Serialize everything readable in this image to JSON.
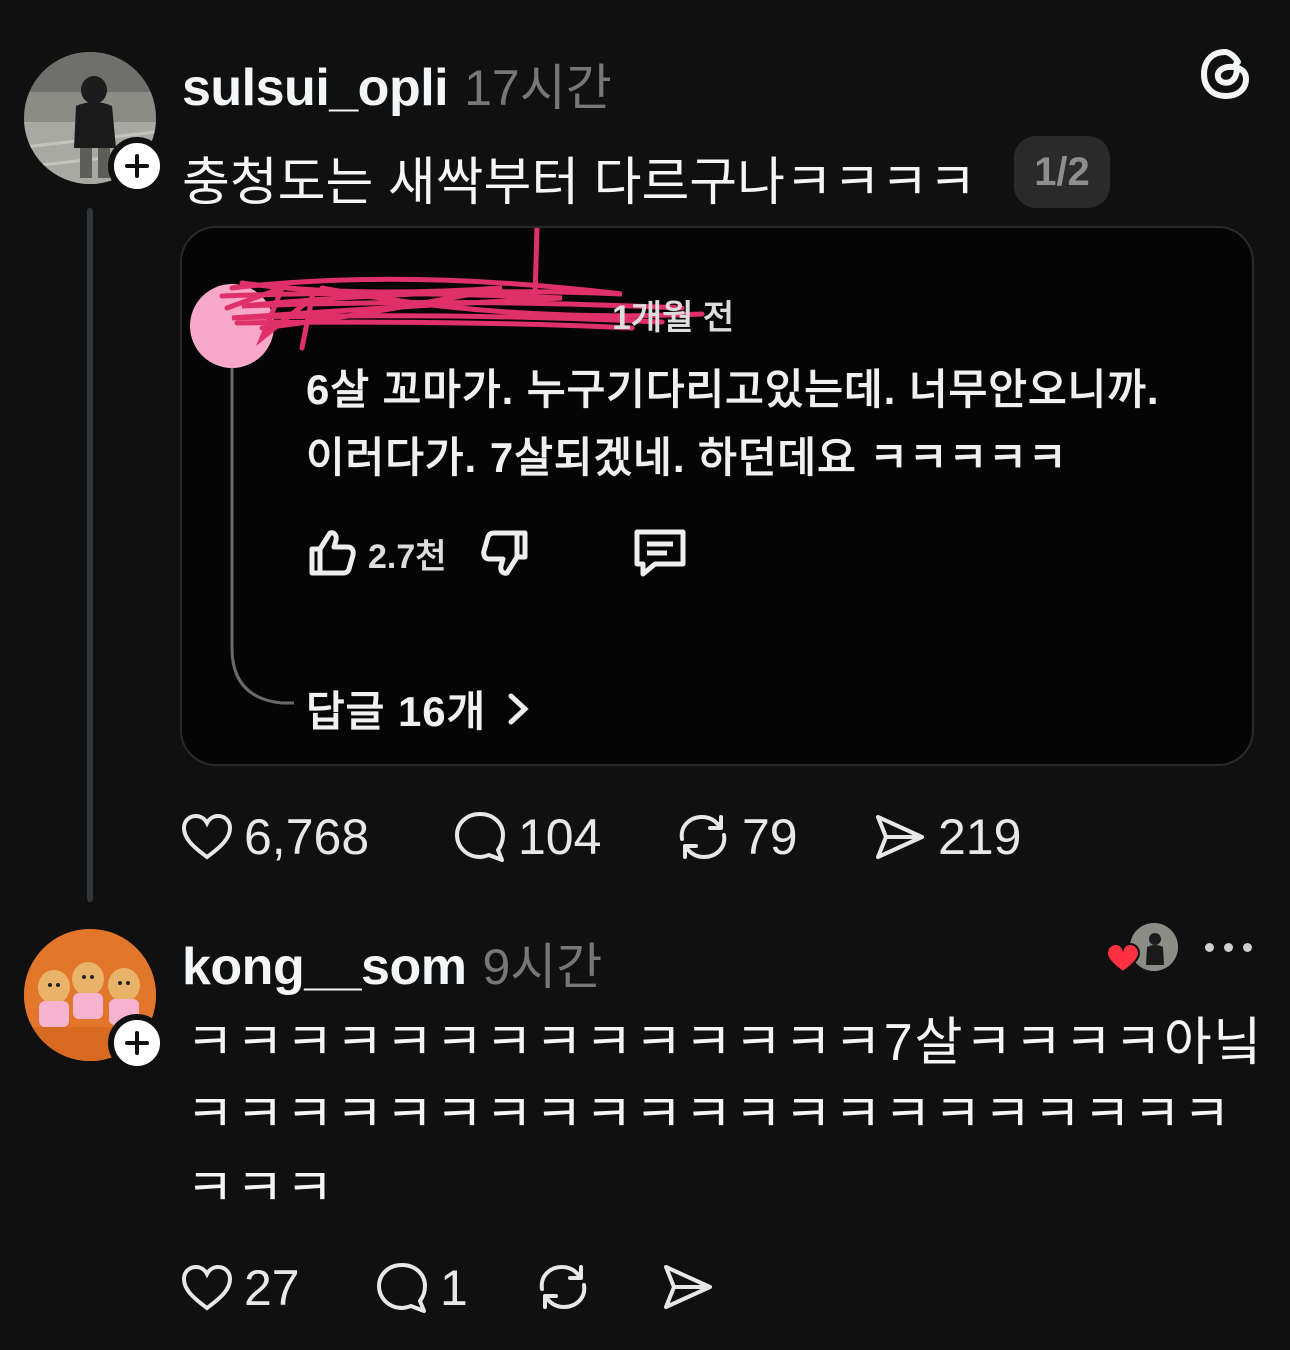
{
  "post": {
    "username": "sulsui_opli",
    "time": "17시간",
    "text": "충청도는 새싹부터 다르구나ㅋㅋㅋㅋ",
    "page_indicator": "1/2",
    "media": {
      "scribble_time": "1개월 전",
      "line1": "6살 꼬마가. 누구기다리고있는데. 너무안오니까.",
      "line2": "이러다가. 7살되겠네. 하던데요 ㅋㅋㅋㅋㅋ",
      "like_count": "2.7천",
      "replies": "답글 16개"
    },
    "stats": {
      "likes": "6,768",
      "comments": "104",
      "reposts": "79",
      "shares": "219"
    }
  },
  "comment": {
    "username": "kong__som",
    "time": "9시간",
    "line1": "ㅋㅋㅋㅋㅋㅋㅋㅋㅋㅋㅋㅋㅋㅋ7살ㅋㅋㅋㅋ아닠",
    "line2": "ㅋㅋㅋㅋㅋㅋㅋㅋㅋㅋㅋㅋㅋㅋㅋㅋㅋㅋㅋㅋㅋ",
    "line3": "ㅋㅋㅋ",
    "stats": {
      "likes": "27",
      "comments": "1"
    }
  },
  "icons": {
    "app_logo": "threads-logo-icon",
    "like": "heart-icon",
    "comment": "speech-bubble-icon",
    "repost": "repost-icon",
    "share": "send-icon",
    "more": "more-dots-icon",
    "follow": "plus-icon"
  },
  "colors": {
    "background": "#101010",
    "text": "#f3f5f7",
    "muted": "#777777",
    "heart": "#ff3040",
    "scribble": "#e0306a"
  }
}
